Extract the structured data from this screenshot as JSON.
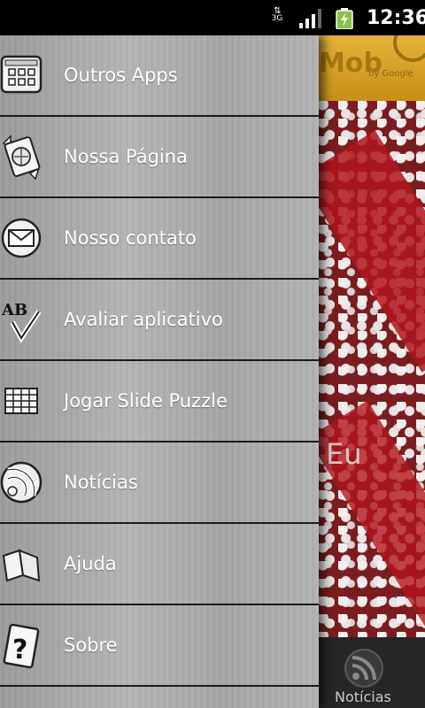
{
  "status_bar": {
    "network": "3G",
    "time": "12:36"
  },
  "drawer": {
    "items": [
      {
        "label": "Outros Apps",
        "icon": "apps-grid-icon"
      },
      {
        "label": "Nossa Página",
        "icon": "globe-page-icon"
      },
      {
        "label": "Nosso contato",
        "icon": "mail-icon"
      },
      {
        "label": "Avaliar aplicativo",
        "icon": "rate-check-icon"
      },
      {
        "label": "Jogar Slide Puzzle",
        "icon": "puzzle-grid-icon"
      },
      {
        "label": "Notícias",
        "icon": "rss-icon"
      },
      {
        "label": "Ajuda",
        "icon": "book-icon"
      },
      {
        "label": "Sobre",
        "icon": "question-card-icon"
      }
    ]
  },
  "background_app": {
    "banner_text": "Mob",
    "banner_sub": "by Google",
    "partial_title": "Eu",
    "tab_label": "Notícias"
  },
  "colors": {
    "drawer_bg": "#a8a8a8",
    "divider": "#1a1a1a",
    "label": "#ffffff",
    "status_bar": "#000000",
    "battery_fill": "#8bc34a"
  }
}
